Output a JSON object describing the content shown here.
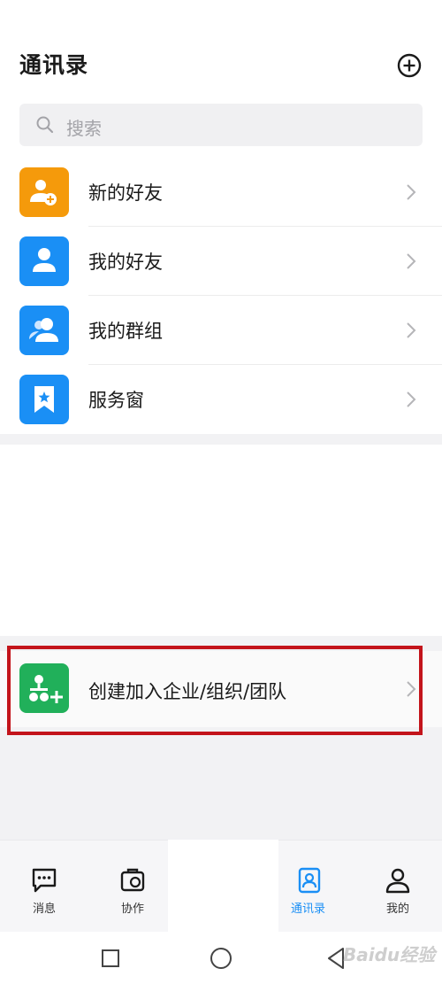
{
  "header": {
    "title": "通讯录",
    "add_icon": "circle-plus-icon"
  },
  "search": {
    "placeholder": "搜索",
    "icon": "search-icon"
  },
  "contacts_menu": [
    {
      "label": "新的好友",
      "icon": "person-add-icon",
      "color": "#f59a0b"
    },
    {
      "label": "我的好友",
      "icon": "person-icon",
      "color": "#1a8ff5"
    },
    {
      "label": "我的群组",
      "icon": "group-icon",
      "color": "#1a8ff5"
    },
    {
      "label": "服务窗",
      "icon": "bookmark-star-icon",
      "color": "#1a8ff5"
    }
  ],
  "org": {
    "label": "创建加入企业/组织/团队",
    "icon": "org-add-icon",
    "color": "#21b05a"
  },
  "tabs": [
    {
      "label": "消息",
      "icon": "message-icon",
      "active": false
    },
    {
      "label": "协作",
      "icon": "collaborate-icon",
      "active": false
    },
    {
      "label": "通讯录",
      "icon": "contacts-icon",
      "active": true
    },
    {
      "label": "我的",
      "icon": "profile-icon",
      "active": false
    }
  ],
  "colors": {
    "accent": "#1a8ff5",
    "highlight": "#c3141b"
  },
  "system_nav": {
    "recent": "square-icon",
    "home": "circle-icon",
    "back": "triangle-back-icon"
  },
  "watermark": "Baidu经验"
}
